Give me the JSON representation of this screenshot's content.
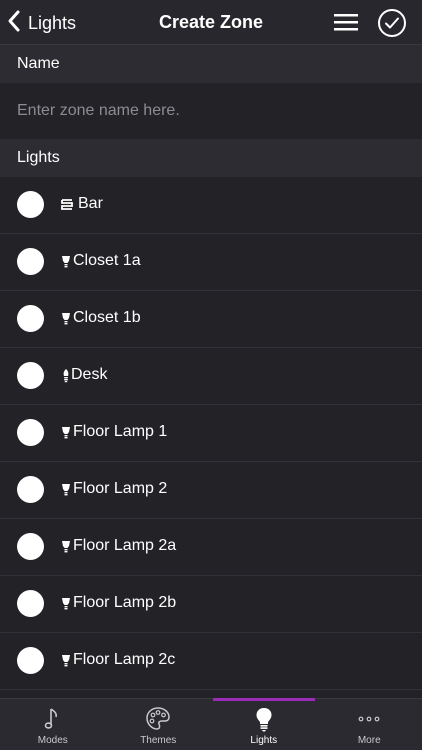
{
  "navbar": {
    "back_label": "Lights",
    "title": "Create Zone"
  },
  "sections": {
    "name_header": "Name",
    "lights_header": "Lights"
  },
  "name_input": {
    "placeholder": "Enter zone name here.",
    "value": ""
  },
  "lights": [
    {
      "label": "Bar",
      "icon": "lightstrip-icon",
      "selected": false
    },
    {
      "label": "Closet 1a",
      "icon": "bulb-spot-icon",
      "selected": false
    },
    {
      "label": "Closet 1b",
      "icon": "bulb-spot-icon",
      "selected": false
    },
    {
      "label": "Desk",
      "icon": "bulb-candle-icon",
      "selected": false
    },
    {
      "label": "Floor Lamp 1",
      "icon": "bulb-spot-icon",
      "selected": false
    },
    {
      "label": "Floor Lamp 2",
      "icon": "bulb-spot-icon",
      "selected": false
    },
    {
      "label": "Floor Lamp 2a",
      "icon": "bulb-spot-icon",
      "selected": false
    },
    {
      "label": "Floor Lamp 2b",
      "icon": "bulb-spot-icon",
      "selected": false
    },
    {
      "label": "Floor Lamp 2c",
      "icon": "bulb-spot-icon",
      "selected": false
    }
  ],
  "tabbar": {
    "tabs": [
      {
        "label": "Modes",
        "icon": "music-note-icon",
        "active": false
      },
      {
        "label": "Themes",
        "icon": "palette-icon",
        "active": false
      },
      {
        "label": "Lights",
        "icon": "lightbulb-icon",
        "active": true
      },
      {
        "label": "More",
        "icon": "more-dots-icon",
        "active": false
      }
    ]
  },
  "colors": {
    "background": "#232227",
    "section_header": "#2d2c32",
    "accent": "#9b2cb7",
    "text": "#ffffff",
    "placeholder": "#8d8c92"
  }
}
